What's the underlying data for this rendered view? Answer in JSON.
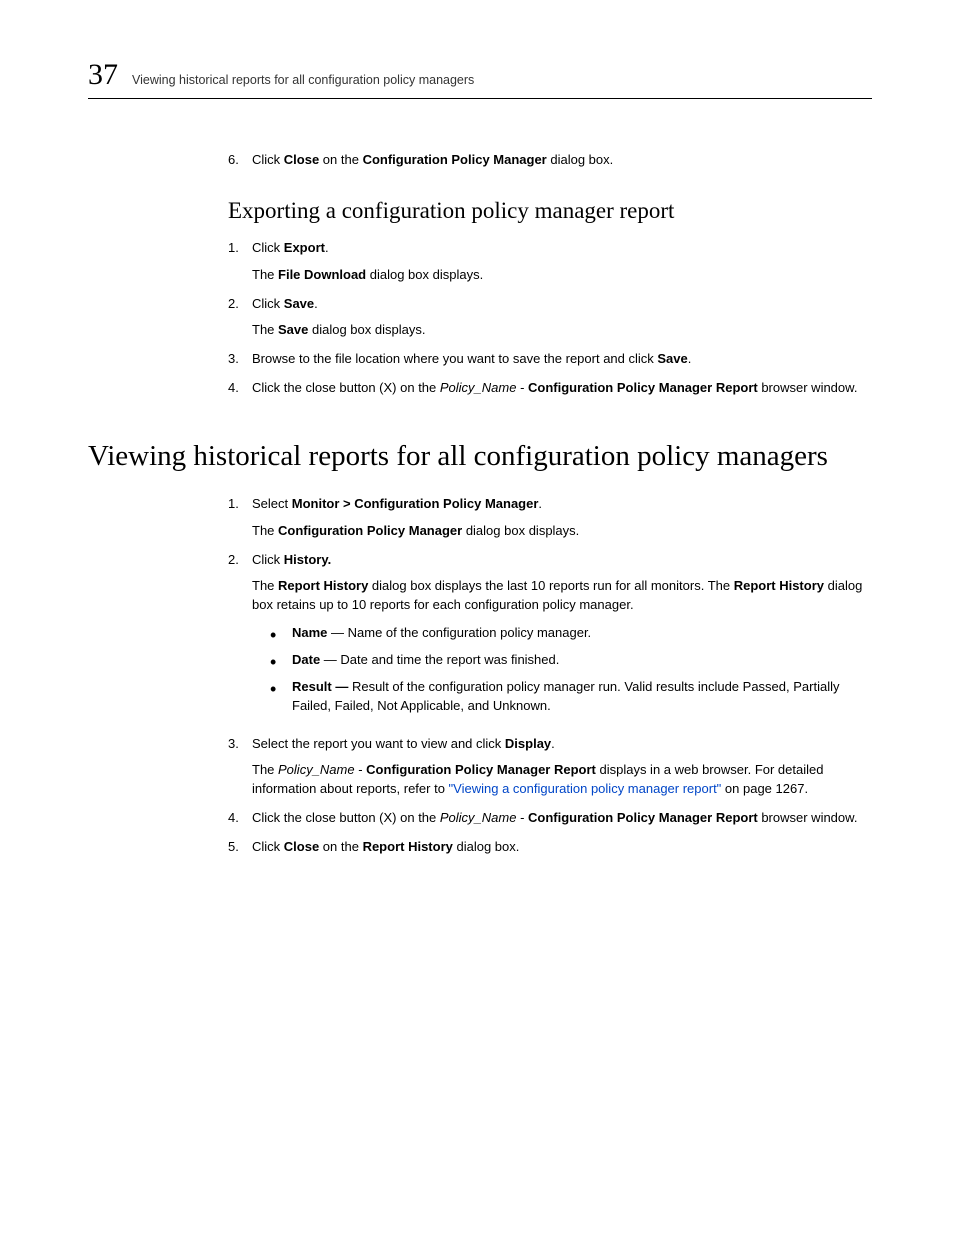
{
  "header": {
    "chapter": "37",
    "running": "Viewing historical reports for all configuration policy managers"
  },
  "top_step": {
    "num": "6.",
    "t1": "Click ",
    "b1": "Close",
    "t2": " on the ",
    "b2": "Configuration Policy Manager",
    "t3": " dialog box."
  },
  "h2": "Exporting a configuration policy manager report",
  "export_steps": {
    "s1": {
      "num": "1.",
      "t1": "Click ",
      "b1": "Export",
      "t2": ".",
      "p2a": "The ",
      "p2b": "File Download",
      "p2c": " dialog box displays."
    },
    "s2": {
      "num": "2.",
      "t1": "Click ",
      "b1": "Save",
      "t2": ".",
      "p2a": "The ",
      "p2b": "Save",
      "p2c": " dialog box displays."
    },
    "s3": {
      "num": "3.",
      "t1": "Browse to the file location where you want to save the report and click ",
      "b1": "Save",
      "t2": "."
    },
    "s4": {
      "num": "4.",
      "t1": "Click the close button (X) on the ",
      "i1": "Policy_Name",
      "t2": " - ",
      "b1": "Configuration Policy Manager Report",
      "t3": " browser window."
    }
  },
  "h1": "Viewing historical reports for all configuration policy managers",
  "view_steps": {
    "s1": {
      "num": "1.",
      "t1": "Select ",
      "b1": "Monitor > Configuration Policy Manager",
      "t2": ".",
      "p2a": "The ",
      "p2b": "Configuration Policy Manager",
      "p2c": " dialog box displays."
    },
    "s2": {
      "num": "2.",
      "t1": "Click ",
      "b1": "History.",
      "p2a": "The ",
      "p2b": "Report History",
      "p2c": " dialog box displays the last 10 reports run for all monitors. The ",
      "p2d": "Report History",
      "p2e": " dialog box retains up to 10 reports for each configuration policy manager."
    },
    "bullets": {
      "b1": {
        "lbl": "Name",
        "txt": " — Name of the configuration policy manager."
      },
      "b2": {
        "lbl": "Date",
        "txt": " — Date and time the report was finished."
      },
      "b3": {
        "lbl": "Result —",
        "txt": " Result of the configuration policy manager run. Valid results include Passed, Partially Failed, Failed, Not Applicable, and Unknown."
      }
    },
    "s3": {
      "num": "3.",
      "t1": "Select the report you want to view and click ",
      "b1": "Display",
      "t2": ".",
      "p2a": "The ",
      "p2i": "Policy_Name",
      "p2b": " - ",
      "p2c": "Configuration Policy Manager Report",
      "p2d": " displays in a web browser. For detailed information about reports, refer to ",
      "p2link": "\"Viewing a configuration policy manager report\"",
      "p2e": " on page 1267."
    },
    "s4": {
      "num": "4.",
      "t1": "Click the close button (X) on the ",
      "i1": "Policy_Name",
      "t2": " - ",
      "b1": "Configuration Policy Manager Report",
      "t3": " browser window."
    },
    "s5": {
      "num": "5.",
      "t1": "Click ",
      "b1": "Close",
      "t2": " on the ",
      "b2": "Report History",
      "t3": " dialog box."
    }
  }
}
